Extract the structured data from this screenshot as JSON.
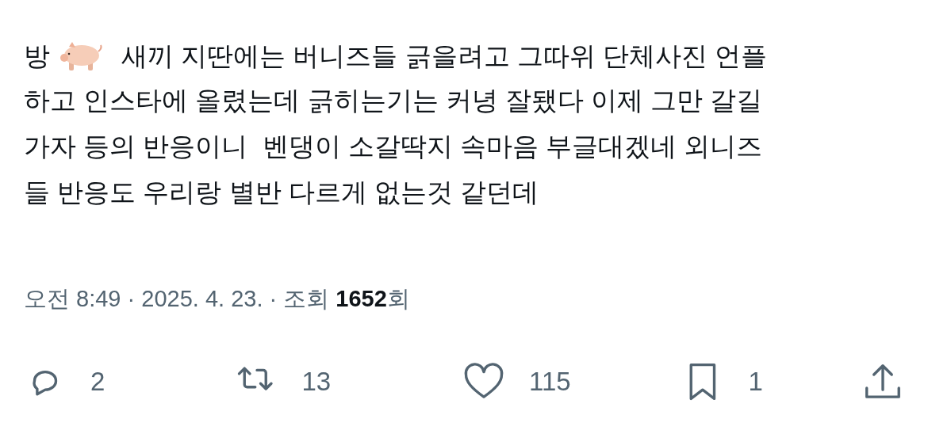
{
  "post": {
    "first_line": {
      "before": "방",
      "after": "새끼 지딴에는 버니즈들 긁을려고 그따위 단체사진 언플"
    },
    "lines": [
      "하고 인스타에 올렸는데 긁히는기는 커녕 잘됐다 이제 그만 갈길",
      "가자 등의 반응이니  벤댕이 소갈딱지 속마음 부글대겠네 외니즈",
      "들 반응도 우리랑 별반 다르게 없는것 같던데"
    ],
    "meta": "오전 8:49 · 2025. 4. 23. · 조회 **1652**회"
  },
  "actions": [
    {
      "kind": "reply",
      "count": "2"
    },
    {
      "kind": "repost",
      "count": "13"
    },
    {
      "kind": "like",
      "count": "115"
    },
    {
      "kind": "bookmark",
      "count": "1"
    },
    {
      "kind": "share"
    }
  ]
}
